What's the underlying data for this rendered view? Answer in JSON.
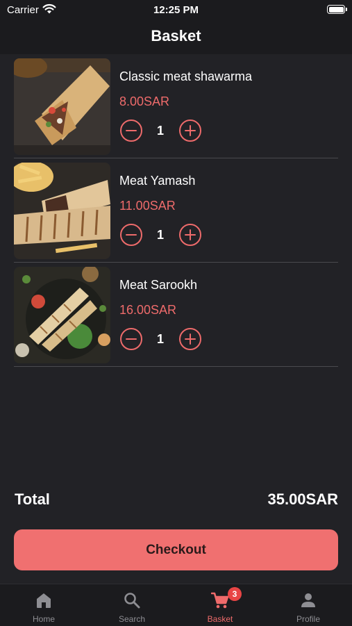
{
  "status_bar": {
    "carrier": "Carrier",
    "time": "12:25 PM"
  },
  "header": {
    "title": "Basket"
  },
  "basket": {
    "items": [
      {
        "name": "Classic meat shawarma",
        "price": "8.00SAR",
        "quantity": "1"
      },
      {
        "name": "Meat Yamash",
        "price": "11.00SAR",
        "quantity": "1"
      },
      {
        "name": "Meat Sarookh",
        "price": "16.00SAR",
        "quantity": "1"
      }
    ]
  },
  "summary": {
    "total_label": "Total",
    "total_value": "35.00SAR"
  },
  "checkout": {
    "label": "Checkout"
  },
  "tab_bar": {
    "tabs": [
      {
        "label": "Home",
        "icon": "home-icon"
      },
      {
        "label": "Search",
        "icon": "search-icon"
      },
      {
        "label": "Basket",
        "icon": "cart-icon",
        "badge": "3",
        "active": true
      },
      {
        "label": "Profile",
        "icon": "person-icon"
      }
    ]
  },
  "colors": {
    "accent": "#ee6b6b",
    "button": "#f07070",
    "background": "#222226",
    "badge": "#e84545"
  }
}
